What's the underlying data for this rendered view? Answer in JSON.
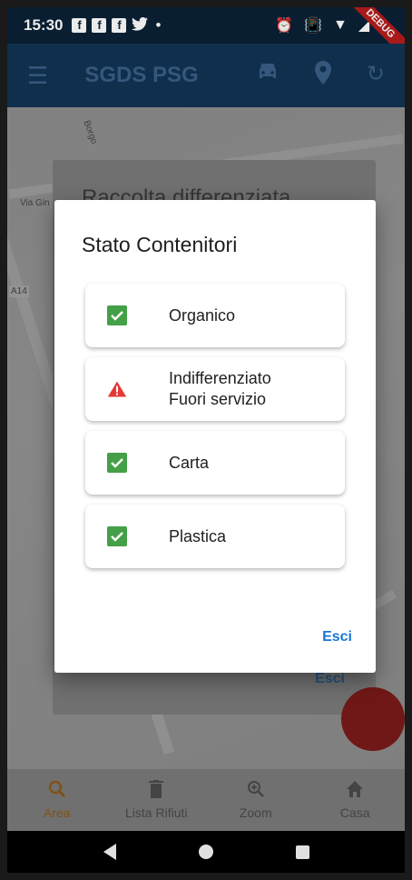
{
  "status_bar": {
    "time": "15:30",
    "notifications": [
      "f",
      "f",
      "f"
    ],
    "debug_banner": "DEBUG"
  },
  "app_bar": {
    "title": "SGDS PSG",
    "icons": [
      "menu-icon",
      "car-icon",
      "location-pin-icon",
      "refresh-icon"
    ]
  },
  "background_dialog": {
    "title": "Raccolta differenziata",
    "action": "Esci"
  },
  "map_labels": [
    "Borgo",
    "Via Gin",
    "A14"
  ],
  "dialog": {
    "title": "Stato Contenitori",
    "items": [
      {
        "status": "ok",
        "lines": [
          "Organico"
        ]
      },
      {
        "status": "warning",
        "lines": [
          "Indifferenziato",
          "Fuori servizio"
        ]
      },
      {
        "status": "ok",
        "lines": [
          "Carta"
        ]
      },
      {
        "status": "ok",
        "lines": [
          "Plastica"
        ]
      }
    ],
    "close_label": "Esci"
  },
  "bottom_nav": {
    "items": [
      {
        "label": "Area",
        "icon": "search-icon",
        "active": true
      },
      {
        "label": "Lista Rifiuti",
        "icon": "trash-icon",
        "active": false
      },
      {
        "label": "Zoom",
        "icon": "zoom-icon",
        "active": false
      },
      {
        "label": "Casa",
        "icon": "home-icon",
        "active": false
      }
    ]
  },
  "colors": {
    "ok": "#43a047",
    "warning": "#e53935",
    "accent": "#1976d2",
    "app_bar": "#0a2236"
  }
}
